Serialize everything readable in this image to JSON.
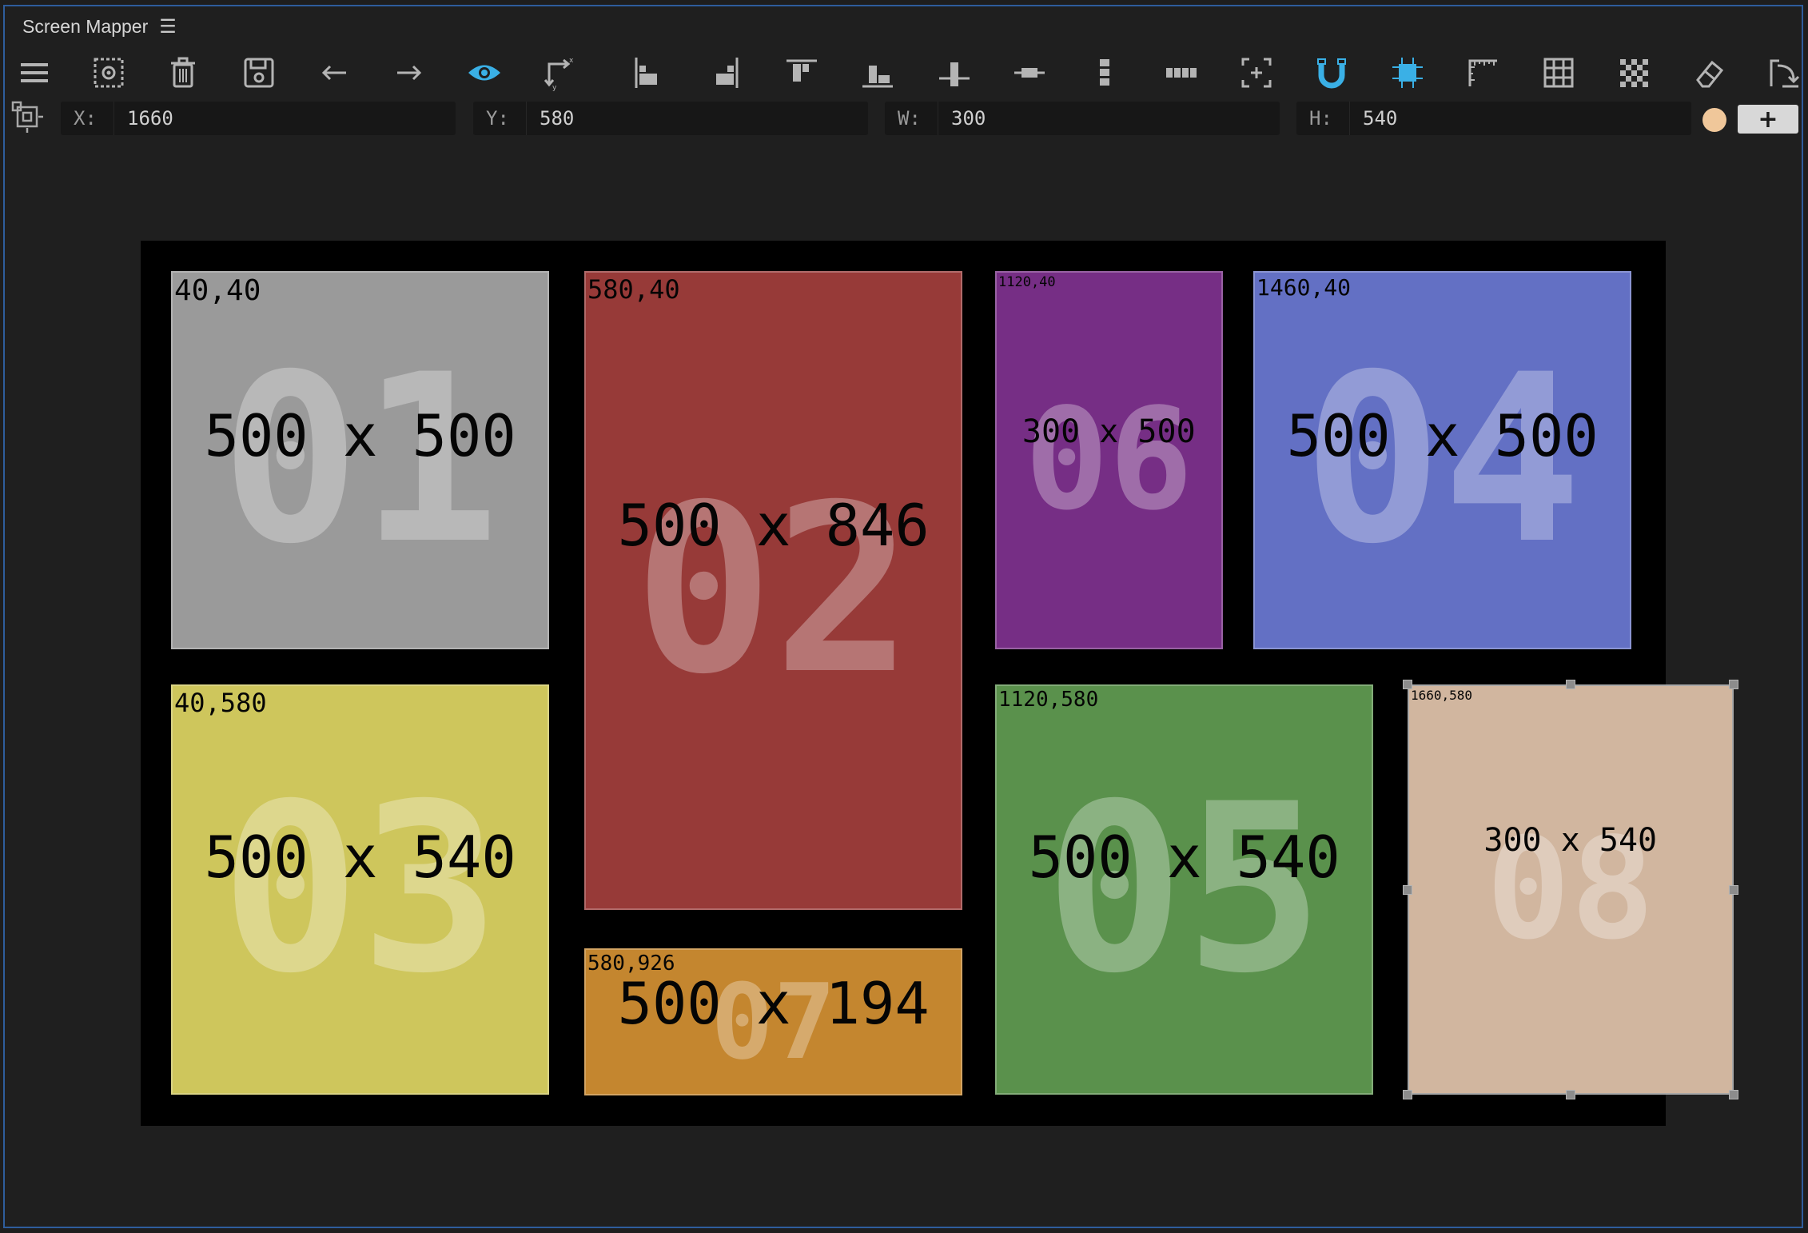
{
  "app": {
    "title": "Screen Mapper",
    "title_menu_icon": "hamburger-icon"
  },
  "colors": {
    "accent": "#3ab0e6",
    "window_border": "#2e5d9c",
    "selected_swatch": "#f0c79a"
  },
  "toolbar": {
    "items": [
      {
        "name": "menu-icon",
        "active": false
      },
      {
        "name": "screen-settings-icon",
        "active": false
      },
      {
        "name": "delete-icon",
        "active": false
      },
      {
        "name": "save-icon",
        "active": false
      },
      {
        "name": "undo-arrow-icon",
        "active": false
      },
      {
        "name": "redo-arrow-icon",
        "active": false
      },
      {
        "name": "visibility-eye-icon",
        "active": true
      },
      {
        "name": "transform-xy-icon",
        "active": false
      },
      {
        "name": "align-left-icon",
        "active": false
      },
      {
        "name": "align-right-icon",
        "active": false
      },
      {
        "name": "align-top-icon",
        "active": false
      },
      {
        "name": "align-bottom-icon",
        "active": false
      },
      {
        "name": "align-vertical-center-icon",
        "active": false
      },
      {
        "name": "align-horizontal-center-icon",
        "active": false
      },
      {
        "name": "distribute-vertical-icon",
        "active": false
      },
      {
        "name": "distribute-horizontal-icon",
        "active": false
      },
      {
        "name": "fit-selection-icon",
        "active": false
      },
      {
        "name": "snap-magnet-icon",
        "active": true
      },
      {
        "name": "snap-to-screens-icon",
        "active": true
      },
      {
        "name": "ruler-icon",
        "active": false
      },
      {
        "name": "grid-icon",
        "active": false
      },
      {
        "name": "checkerboard-icon",
        "active": false
      },
      {
        "name": "eraser-icon",
        "active": false
      },
      {
        "name": "export-icon",
        "active": false
      }
    ]
  },
  "properties": {
    "icon": "selection-transform-icon",
    "x": {
      "label": "X:",
      "value": "1660"
    },
    "y": {
      "label": "Y:",
      "value": "580"
    },
    "w": {
      "label": "W:",
      "value": "300"
    },
    "h": {
      "label": "H:",
      "value": "540"
    },
    "add_label": "+"
  },
  "screens": [
    {
      "id": "01",
      "coord": "40,40",
      "dims": "500 x 500",
      "color": "#9a9a9a",
      "selected": false
    },
    {
      "id": "02",
      "coord": "580,40",
      "dims": "500 x 846",
      "color": "#973a38",
      "selected": false
    },
    {
      "id": "06",
      "coord": "1120,40",
      "dims": "300 x 500",
      "color": "#762e85",
      "selected": false
    },
    {
      "id": "04",
      "coord": "1460,40",
      "dims": "500 x 500",
      "color": "#6370c4",
      "selected": false
    },
    {
      "id": "03",
      "coord": "40,580",
      "dims": "500 x 540",
      "color": "#cec65c",
      "selected": false
    },
    {
      "id": "07",
      "coord": "580,926",
      "dims": "500 x 194",
      "color": "#c4862f",
      "selected": false
    },
    {
      "id": "05",
      "coord": "1120,580",
      "dims": "500 x 540",
      "color": "#5a914c",
      "selected": false
    },
    {
      "id": "08",
      "coord": "1660,580",
      "dims": "300 x 540",
      "color": "#d1b69f",
      "selected": true
    }
  ]
}
